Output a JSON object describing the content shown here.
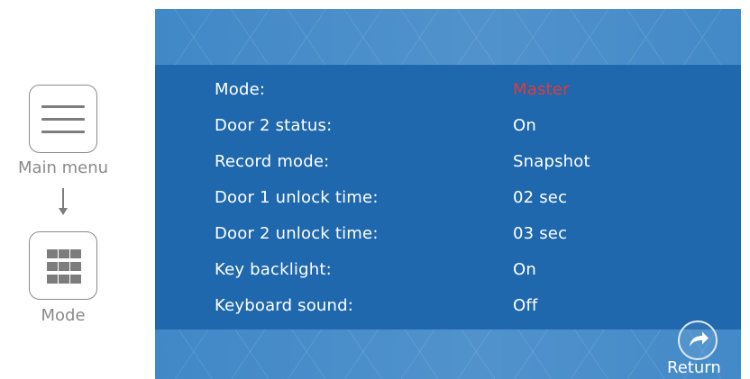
{
  "guide": {
    "step1": {
      "label": "Main menu",
      "icon": "hamburger-menu-icon"
    },
    "step2": {
      "label": "Mode",
      "icon": "grid-icon"
    }
  },
  "settings": [
    {
      "label": "Mode:",
      "value": "Master",
      "highlighted": true
    },
    {
      "label": "Door 2 status:",
      "value": "On"
    },
    {
      "label": "Record mode:",
      "value": "Snapshot"
    },
    {
      "label": "Door 1 unlock time:",
      "value": "02 sec"
    },
    {
      "label": "Door 2 unlock time:",
      "value": "03 sec"
    },
    {
      "label": "Key backlight:",
      "value": "On"
    },
    {
      "label": "Keyboard sound:",
      "value": "Off"
    }
  ],
  "footer": {
    "return_label": "Return",
    "return_icon": "return-arrow-icon"
  },
  "colors": {
    "screen_background": "#1f68ad",
    "band_background": "#3d86c6",
    "highlight_value": "#e03a3e",
    "text": "#ffffff",
    "guide_gray": "#8a8a8a"
  }
}
